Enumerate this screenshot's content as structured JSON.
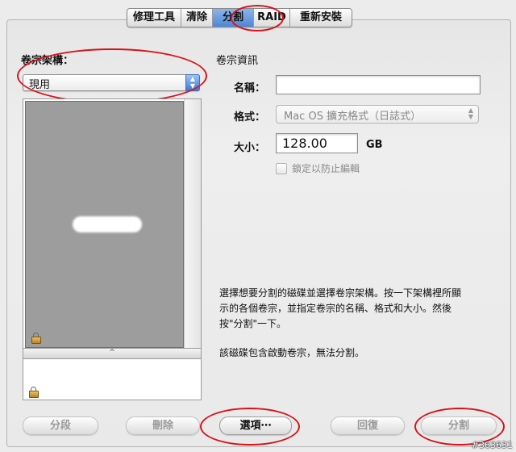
{
  "tabs": [
    "修理工具",
    "清除",
    "分割",
    "RAID",
    "重新安裝"
  ],
  "active_tab": "分割",
  "volume_scheme": {
    "label": "卷宗架構：",
    "selected": "現用"
  },
  "layout": {
    "resize_handle": "^"
  },
  "volume_info": {
    "heading": "卷宗資訊",
    "name_label": "名稱：",
    "format_label": "格式：",
    "format_value": "Mac OS 擴充格式（日誌式）",
    "size_label": "大小：",
    "size_value": "128.00",
    "size_unit": "GB",
    "lock_label": "鎖定以防止編輯"
  },
  "instructions": {
    "line1": "選擇想要分割的磁碟並選擇卷宗架構。按一下架構裡所顯",
    "line2": "示的各個卷宗，並指定卷宗的名稱、格式和大小。然後",
    "line3": "按\"分割\"一下。",
    "warning": "該磁碟包含啟動卷宗，無法分割。"
  },
  "buttons": {
    "split": "分段",
    "delete": "刪除",
    "options": "選項⋯",
    "revert": "回復",
    "partition": "分割"
  },
  "watermark": "#363631",
  "colors": {
    "annotation_red": "#d8131b",
    "active_tab_blue": "#4d86d6"
  }
}
